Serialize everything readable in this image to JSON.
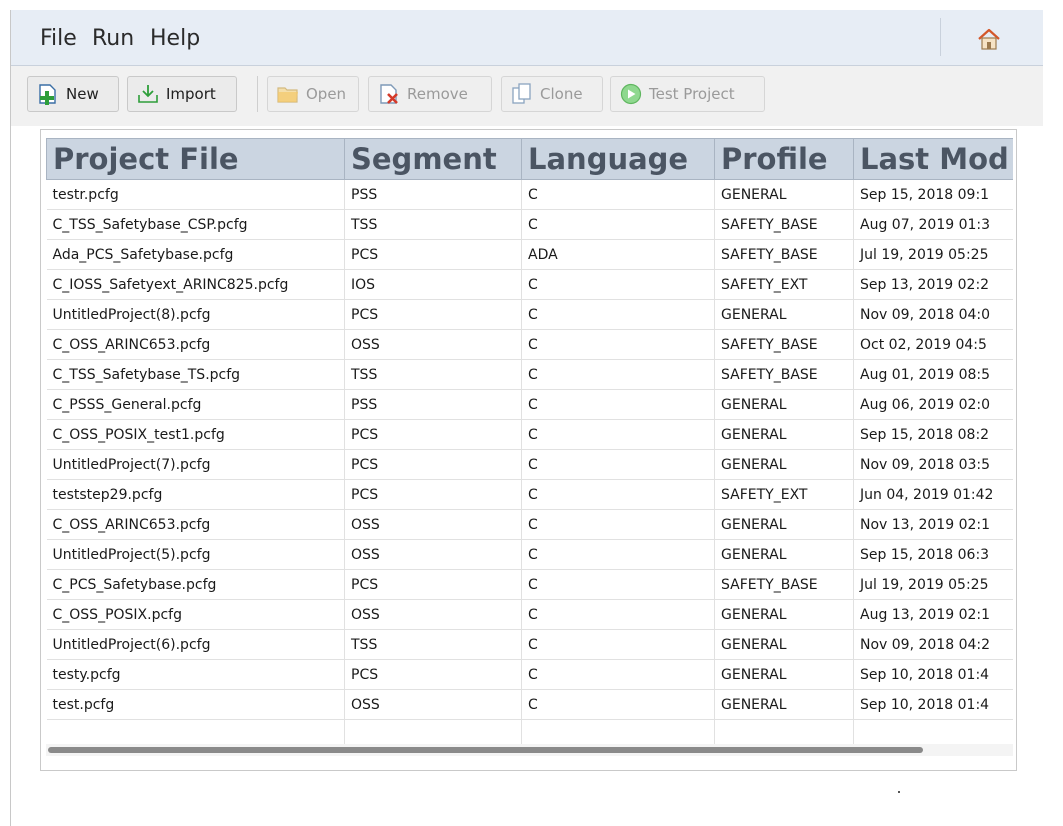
{
  "menu": {
    "file": "File",
    "run": "Run",
    "help": "Help"
  },
  "toolbar": {
    "new": "New",
    "import": "Import",
    "open": "Open",
    "remove": "Remove",
    "clone": "Clone",
    "test_project": "Test Project"
  },
  "table": {
    "columns": [
      "Project File",
      "Segment",
      "Language",
      "Profile",
      "Last Mod"
    ],
    "rows": [
      [
        "testr.pcfg",
        "PSS",
        "C",
        "GENERAL",
        "Sep 15, 2018 09:1"
      ],
      [
        "C_TSS_Safetybase_CSP.pcfg",
        "TSS",
        "C",
        "SAFETY_BASE",
        "Aug 07, 2019 01:3"
      ],
      [
        "Ada_PCS_Safetybase.pcfg",
        "PCS",
        "ADA",
        "SAFETY_BASE",
        "Jul 19, 2019 05:25"
      ],
      [
        "C_IOSS_Safetyext_ARINC825.pcfg",
        "IOS",
        "C",
        "SAFETY_EXT",
        "Sep 13, 2019 02:2"
      ],
      [
        "UntitledProject(8).pcfg",
        "PCS",
        "C",
        "GENERAL",
        "Nov 09, 2018 04:0"
      ],
      [
        "C_OSS_ARINC653.pcfg",
        "OSS",
        "C",
        "SAFETY_BASE",
        "Oct 02, 2019 04:5"
      ],
      [
        "C_TSS_Safetybase_TS.pcfg",
        "TSS",
        "C",
        "SAFETY_BASE",
        "Aug 01, 2019 08:5"
      ],
      [
        "C_PSSS_General.pcfg",
        "PSS",
        "C",
        "GENERAL",
        "Aug 06, 2019 02:0"
      ],
      [
        "C_OSS_POSIX_test1.pcfg",
        "PCS",
        "C",
        "GENERAL",
        "Sep 15, 2018 08:2"
      ],
      [
        "UntitledProject(7).pcfg",
        "PCS",
        "C",
        "GENERAL",
        "Nov 09, 2018 03:5"
      ],
      [
        "teststep29.pcfg",
        "PCS",
        "C",
        "SAFETY_EXT",
        "Jun 04, 2019 01:42"
      ],
      [
        "C_OSS_ARINC653.pcfg",
        "OSS",
        "C",
        "GENERAL",
        "Nov 13, 2019 02:1"
      ],
      [
        "UntitledProject(5).pcfg",
        "OSS",
        "C",
        "GENERAL",
        "Sep 15, 2018 06:3"
      ],
      [
        "C_PCS_Safetybase.pcfg",
        "PCS",
        "C",
        "SAFETY_BASE",
        "Jul 19, 2019 05:25"
      ],
      [
        "C_OSS_POSIX.pcfg",
        "OSS",
        "C",
        "GENERAL",
        "Aug 13, 2019 02:1"
      ],
      [
        "UntitledProject(6).pcfg",
        "TSS",
        "C",
        "GENERAL",
        "Nov 09, 2018 04:2"
      ],
      [
        "testy.pcfg",
        "PCS",
        "C",
        "GENERAL",
        "Sep 10, 2018 01:4"
      ],
      [
        "test.pcfg",
        "OSS",
        "C",
        "GENERAL",
        "Sep 10, 2018 01:4"
      ]
    ]
  },
  "colors": {
    "menubar_bg": "#e7edf5",
    "header_bg": "#cbd5e1",
    "header_text": "#4b5563",
    "accent_green": "#2e9e3a",
    "accent_red": "#d43a2a"
  },
  "icons": {
    "home": "home-icon",
    "new": "new-file-icon",
    "import": "import-icon",
    "open": "open-folder-icon",
    "remove": "remove-icon",
    "clone": "clone-icon",
    "test_project": "play-icon"
  }
}
